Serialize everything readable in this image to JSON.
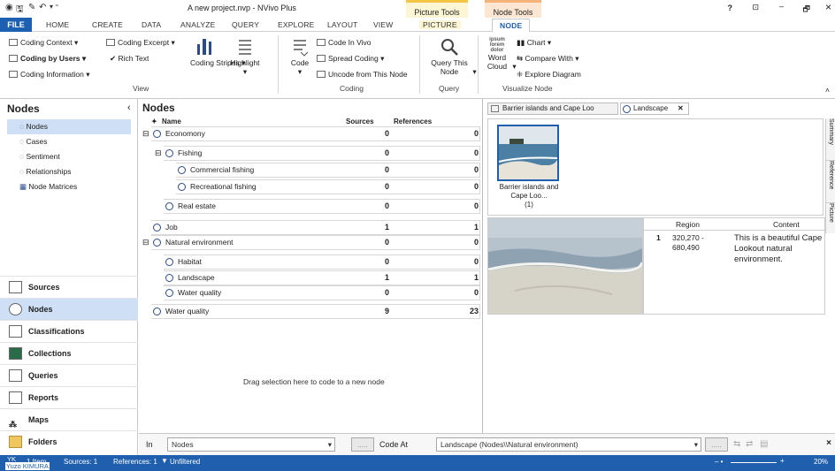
{
  "window": {
    "title": "A new project.nvp - NVivo Plus",
    "context_picture_tools": "Picture Tools",
    "context_node_tools": "Node Tools",
    "controls": {
      "help": "?",
      "restore": "⊡",
      "minimize": "–",
      "maximize": "🗗",
      "close": "×"
    }
  },
  "tabs": [
    "FILE",
    "HOME",
    "CREATE",
    "DATA",
    "ANALYZE",
    "QUERY",
    "EXPLORE",
    "LAYOUT",
    "VIEW",
    "PICTURE",
    "NODE"
  ],
  "ribbon": {
    "view": {
      "coding_context": "Coding Context",
      "coding_by_users": "Coding by Users",
      "coding_information": "Coding Information",
      "coding_excerpt": "Coding Excerpt",
      "rich_text": "Rich Text",
      "coding_stripes": "Coding Stripes",
      "highlight": "Highlight",
      "group": "View"
    },
    "coding": {
      "code": "Code",
      "code_in_vivo": "Code In Vivo",
      "spread_coding": "Spread Coding",
      "uncode": "Uncode from This Node",
      "group": "Coding"
    },
    "query": {
      "query_this_node": "Query This Node",
      "group": "Query"
    },
    "visualize": {
      "word_cloud": "Word Cloud",
      "chart": "Chart",
      "compare_with": "Compare With",
      "explore_diagram": "Explore Diagram",
      "group": "Visualize Node"
    }
  },
  "nav": {
    "title": "Nodes",
    "tree": [
      "Nodes",
      "Cases",
      "Sentiment",
      "Relationships",
      "Node Matrices"
    ],
    "buttons": [
      "Sources",
      "Nodes",
      "Classifications",
      "Collections",
      "Queries",
      "Reports",
      "Maps",
      "Folders"
    ]
  },
  "list": {
    "title": "Nodes",
    "columns": {
      "name": "Name",
      "sources": "Sources",
      "references": "References"
    },
    "rows": [
      {
        "name": "Economony",
        "sources": "0",
        "references": "0"
      },
      {
        "name": "Fishing",
        "sources": "0",
        "references": "0"
      },
      {
        "name": "Commercial fishing",
        "sources": "0",
        "references": "0"
      },
      {
        "name": "Recreational fishing",
        "sources": "0",
        "references": "0"
      },
      {
        "name": "Real estate",
        "sources": "0",
        "references": "0"
      },
      {
        "name": "Job",
        "sources": "1",
        "references": "1"
      },
      {
        "name": "Natural environment",
        "sources": "0",
        "references": "0"
      },
      {
        "name": "Habitat",
        "sources": "0",
        "references": "0"
      },
      {
        "name": "Landscape",
        "sources": "1",
        "references": "1"
      },
      {
        "name": "Water quality",
        "sources": "0",
        "references": "0"
      },
      {
        "name": "Water quality",
        "sources": "9",
        "references": "23"
      }
    ],
    "drag_hint": "Drag selection here to code to a new node"
  },
  "detail": {
    "tabs": [
      "Barrier islands and Cape Loo",
      "Landscape"
    ],
    "thumb_caption": "Barrier islands and Cape Loo...",
    "thumb_count": "(1)",
    "side_tabs": [
      "Summary",
      "Reference",
      "Picture"
    ],
    "table": {
      "headers": [
        "Region",
        "Content"
      ],
      "rows": [
        {
          "num": "1",
          "region": "320,270 - 680,490",
          "content": "This is a beautiful Cape Lookout natural environment."
        }
      ]
    }
  },
  "bottom": {
    "in_label": "In",
    "in_value": "Nodes",
    "code_at_label": "Code At",
    "code_at_value": "Landscape (Nodes\\\\Natural environment)",
    "more": "....."
  },
  "status": {
    "user_initials": "YK",
    "user_name": "Yuzo KIMURA",
    "items": "1 Item",
    "sources": "Sources: 1",
    "references": "References: 1",
    "filter": "Unfiltered",
    "zoom": "20%"
  },
  "colors": {
    "accent": "#1f5fae",
    "picture_tools": "#f4c542",
    "node_tools": "#f5b37a",
    "selected": "#cfe0f6"
  }
}
